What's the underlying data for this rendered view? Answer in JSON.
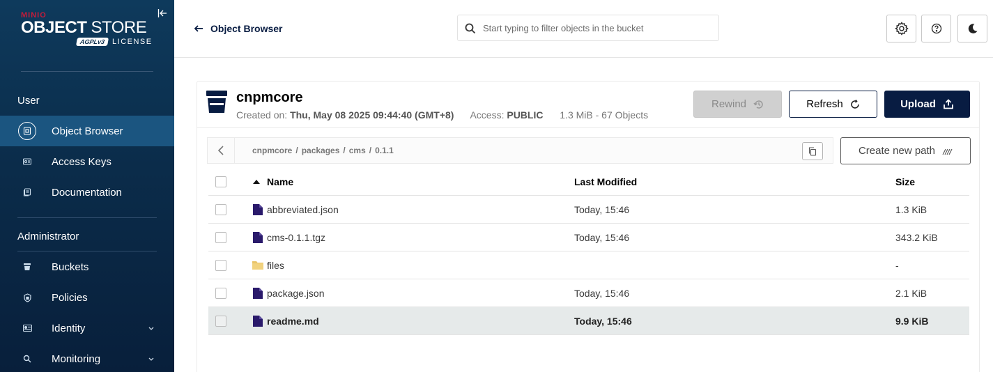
{
  "sidebar": {
    "brand": {
      "minio": "MINIO",
      "object": "OBJECT",
      "store": " STORE",
      "agpl": "AGPLv3",
      "license": "LICENSE"
    },
    "sections": [
      {
        "title": "User"
      },
      {
        "title": "Administrator"
      }
    ],
    "user_items": [
      {
        "label": "Object Browser",
        "icon": "object-browser-icon",
        "active": true
      },
      {
        "label": "Access Keys",
        "icon": "access-keys-icon"
      },
      {
        "label": "Documentation",
        "icon": "documentation-icon"
      }
    ],
    "admin_items": [
      {
        "label": "Buckets",
        "icon": "bucket-icon"
      },
      {
        "label": "Policies",
        "icon": "policy-shield-icon"
      },
      {
        "label": "Identity",
        "icon": "identity-icon",
        "expandable": true
      },
      {
        "label": "Monitoring",
        "icon": "monitoring-icon",
        "expandable": true
      }
    ]
  },
  "header": {
    "back_label": "Object Browser",
    "search": {
      "placeholder": "Start typing to filter objects in the bucket",
      "value": ""
    }
  },
  "bucket": {
    "name": "cnpmcore",
    "created_label": "Created on:",
    "created_value": "Thu, May 08 2025 09:44:40 (GMT+8)",
    "access_label": "Access:",
    "access_value": "PUBLIC",
    "usage": "1.3 MiB - 67 Objects"
  },
  "actions": {
    "rewind": "Rewind",
    "refresh": "Refresh",
    "upload": "Upload",
    "create_path": "Create new path"
  },
  "breadcrumb": [
    "cnpmcore",
    "packages",
    "cms",
    "0.1.1"
  ],
  "table": {
    "headers": {
      "name": "Name",
      "modified": "Last Modified",
      "size": "Size"
    },
    "rows": [
      {
        "name": "abbreviated.json",
        "type": "file",
        "modified": "Today, 15:46",
        "size": "1.3 KiB"
      },
      {
        "name": "cms-0.1.1.tgz",
        "type": "file",
        "modified": "Today, 15:46",
        "size": "343.2 KiB"
      },
      {
        "name": "files",
        "type": "folder",
        "modified": "",
        "size": "-"
      },
      {
        "name": "package.json",
        "type": "file",
        "modified": "Today, 15:46",
        "size": "2.1 KiB"
      },
      {
        "name": "readme.md",
        "type": "file",
        "modified": "Today, 15:46",
        "size": "9.9 KiB",
        "selected": true
      }
    ]
  },
  "colors": {
    "navy": "#081c42",
    "sidebar_active": "#1b5580",
    "file_icon": "#2a1a6b",
    "folder_icon": "#e9c46a"
  }
}
